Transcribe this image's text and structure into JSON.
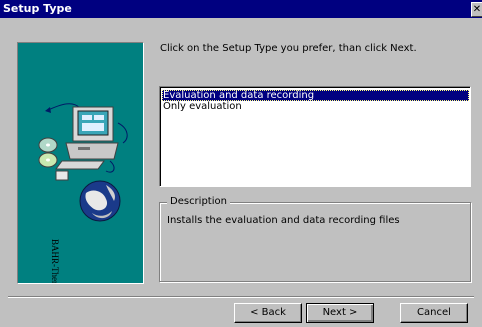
{
  "window": {
    "title": "Setup Type",
    "close_label": "✕"
  },
  "sidebar": {
    "brand_text": "BAHR-Thermoanalyse"
  },
  "instruction": "Click on the Setup Type you prefer, than click Next.",
  "setup_list": {
    "items": [
      {
        "label": "Evaluation and data recording",
        "selected": true
      },
      {
        "label": "Only evaluation",
        "selected": false
      }
    ]
  },
  "description": {
    "legend": "Description",
    "text": "Installs the evaluation and data recording files"
  },
  "buttons": {
    "back": "< Back",
    "next": "Next >",
    "cancel": "Cancel"
  },
  "colors": {
    "title_bar": "#000080",
    "art_panel": "#008080",
    "dialog_face": "#c0c0c0",
    "selection": "#000080"
  }
}
